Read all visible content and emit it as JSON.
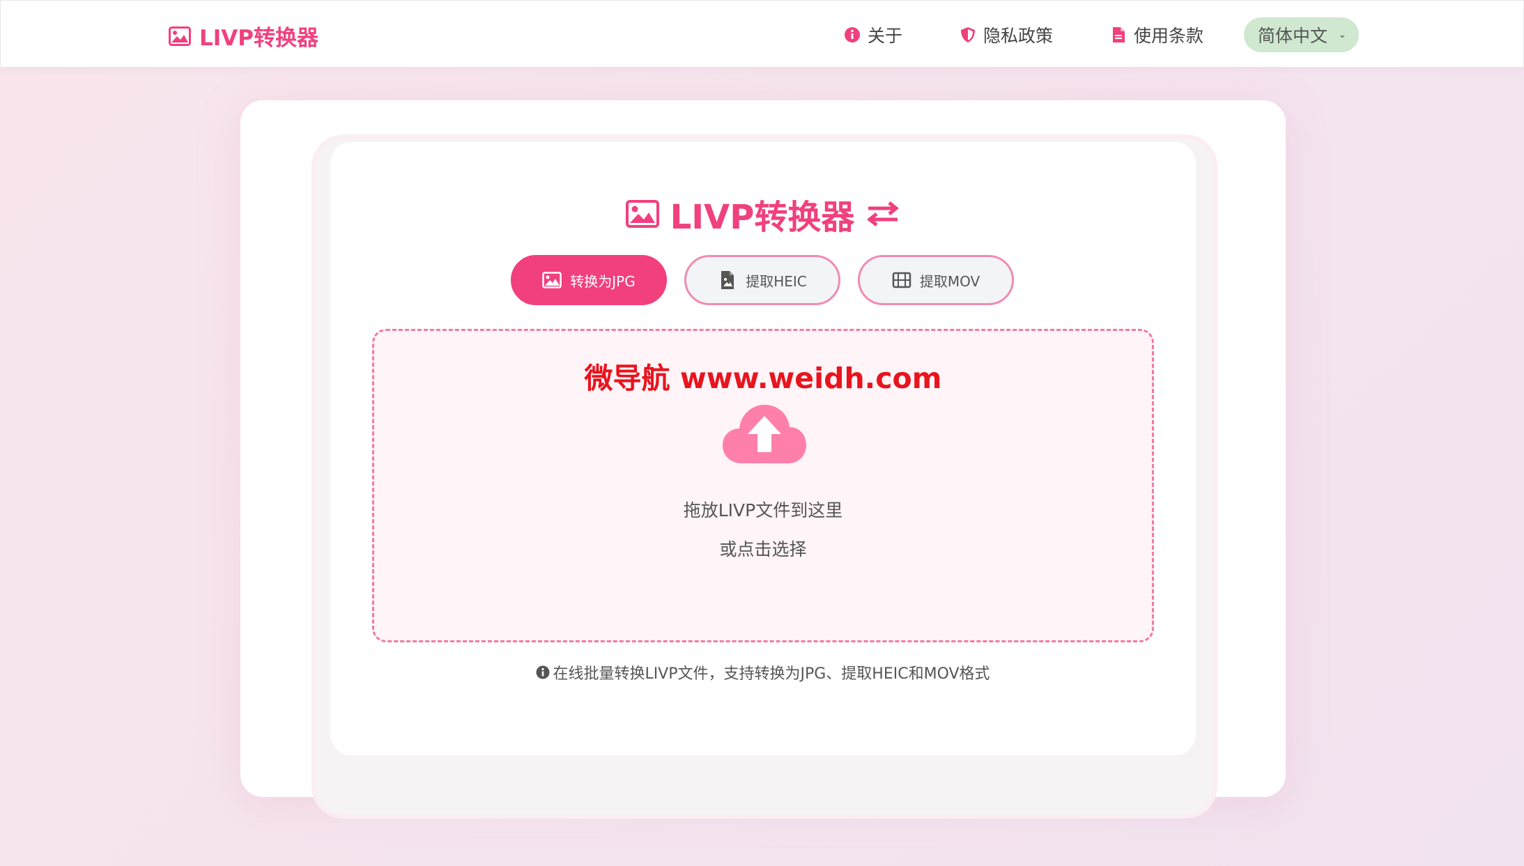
{
  "navbar": {
    "brand": "LIVP转换器",
    "links": [
      {
        "label": "关于",
        "icon": "info-circle-icon"
      },
      {
        "label": "隐私政策",
        "icon": "shield-icon"
      },
      {
        "label": "使用条款",
        "icon": "document-icon"
      }
    ],
    "language": "简体中文"
  },
  "main": {
    "title": "LIVP转换器",
    "tabs": [
      {
        "label": "转换为JPG",
        "icon": "image-icon",
        "active": true
      },
      {
        "label": "提取HEIC",
        "icon": "file-image-icon",
        "active": false
      },
      {
        "label": "提取MOV",
        "icon": "film-icon",
        "active": false
      }
    ],
    "dropzone": {
      "watermark": "微导航 www.weidh.com",
      "primary_text": "拖放LIVP文件到这里",
      "secondary_text": "或点击选择",
      "icon": "cloud-upload-icon"
    },
    "hint": "在线批量转换LIVP文件，支持转换为JPG、提取HEIC和MOV格式"
  },
  "colors": {
    "accent": "#f0407e",
    "tab_active": "#f23f7d",
    "dropzone_border": "#f27aa6",
    "watermark": "#e8141e",
    "language_bg": "#cfe8cf"
  }
}
